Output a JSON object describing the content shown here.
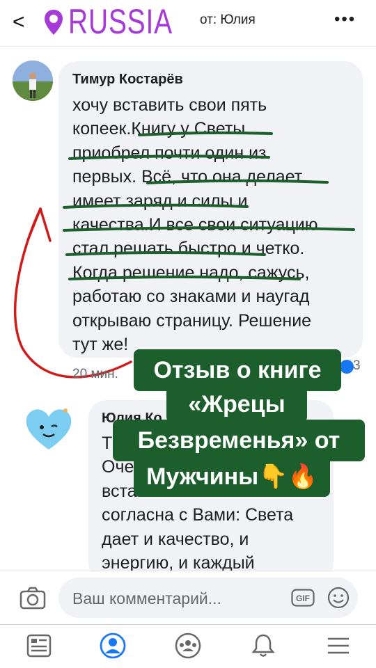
{
  "header": {
    "back_glyph": "<",
    "overlay_title": "RUSSIA",
    "from_label": "от: Юлия",
    "more_glyph": "•••"
  },
  "comment": {
    "author": "Тимур Костарёв",
    "text": "хочу вставить свои пять\nкопеек.Книгу у Светы\nприобрел почти один из\nпервых. Всё, что она делает\nимеет заряд и силы и\nкачества.И все свои ситуацию\nстал решать быстро и четко.\nКогда решение надо, сажусь,\nработаю со знаками и наугад\nоткрываю страницу. Решение\nтут же!",
    "time": "20 мин.",
    "reaction_count": "3"
  },
  "reply": {
    "author": "Юлия Ко",
    "text": "Т\nОче\nвста\nсогласна с Вами: Света\nдает и качество, и\nэнергию, и каждый"
  },
  "overlay": {
    "line1": "Отзыв о книге",
    "line2": "«Жрецы",
    "line3": "Безвременья» от",
    "line4": "Мужчины👇🔥",
    "background": "#1d5e2d"
  },
  "composer": {
    "placeholder": "Ваш комментарий...",
    "gif_label": "GIF"
  },
  "nav": {
    "items": [
      "news-feed-icon",
      "profile-icon",
      "groups-icon",
      "notifications-icon",
      "menu-icon"
    ],
    "active": "profile-icon"
  },
  "colors": {
    "brand_purple": "#a63ad6",
    "facebook_blue": "#1877f2",
    "underline_green": "#1d5e2d",
    "arrow_red": "#d11a1a"
  }
}
